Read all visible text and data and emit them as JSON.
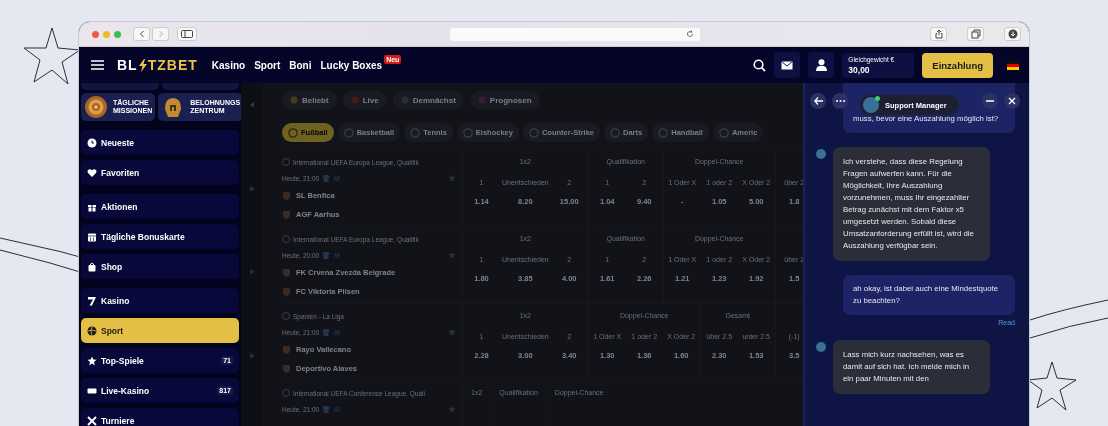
{
  "header": {
    "logo": {
      "left": "BL",
      "right": "TZBET"
    },
    "nav": [
      {
        "label": "Kasino"
      },
      {
        "label": "Sport"
      },
      {
        "label": "Boni"
      },
      {
        "label": "Lucky Boxes",
        "badge": "Neu"
      }
    ],
    "balance_label": "Gleichgewicht €",
    "balance": "30,00",
    "deposit_button": "Einzahlung"
  },
  "sidebar": {
    "promo_cards": [
      {
        "lines": [
          "TÄGLICHE",
          "MISSIONEN"
        ]
      },
      {
        "lines": [
          "BELOHNUNGS",
          "ZENTRUM"
        ]
      }
    ],
    "groups": [
      {
        "items": [
          {
            "label": "Neueste",
            "selected": false
          },
          {
            "label": "Favoriten",
            "selected": false
          }
        ]
      },
      {
        "items": [
          {
            "label": "Aktionen",
            "selected": false
          },
          {
            "label": "Tägliche Bonuskarte",
            "selected": false
          },
          {
            "label": "Shop",
            "selected": false
          }
        ]
      },
      {
        "items": [
          {
            "label": "Kasino",
            "selected": false
          },
          {
            "label": "Sport",
            "selected": true
          },
          {
            "label": "Top-Spiele",
            "selected": false,
            "count": "71"
          },
          {
            "label": "Live-Kasino",
            "selected": false,
            "count": "817"
          },
          {
            "label": "Turniere",
            "selected": false
          }
        ]
      }
    ]
  },
  "filters": [
    {
      "label": "Beliebt"
    },
    {
      "label": "Live"
    },
    {
      "label": "Demnächst"
    },
    {
      "label": "Prognosen"
    }
  ],
  "sports": [
    {
      "label": "Fußball",
      "selected": true
    },
    {
      "label": "Basketball",
      "selected": false
    },
    {
      "label": "Tennis",
      "selected": false
    },
    {
      "label": "Eishockey",
      "selected": false
    },
    {
      "label": "Counter-Strike",
      "selected": false
    },
    {
      "label": "Darts",
      "selected": false
    },
    {
      "label": "Handball",
      "selected": false
    },
    {
      "label": "Americ",
      "selected": false
    }
  ],
  "matches": [
    {
      "league": "International UEFA Europa League, Qualifik",
      "time": "Heute, 21:00",
      "teams": [
        "SL Benfica",
        "AGF Aarhus"
      ],
      "markets": [
        {
          "title": "1x2",
          "outcomes": [
            {
              "label": "1",
              "odd": "1.14"
            },
            {
              "label": "Unentschieden",
              "odd": "8.20"
            },
            {
              "label": "2",
              "odd": "15.00"
            }
          ]
        },
        {
          "title": "Qualifikation",
          "outcomes": [
            {
              "label": "1",
              "odd": "1.04"
            },
            {
              "label": "2",
              "odd": "9.40"
            }
          ]
        },
        {
          "title": "Doppel-Chance",
          "outcomes": [
            {
              "label": "1 Oder X",
              "odd": "-"
            },
            {
              "label": "1 oder 2",
              "odd": "1.05"
            },
            {
              "label": "X Oder 2",
              "odd": "5.00"
            }
          ]
        },
        {
          "outcomes": [
            {
              "label": "über 2",
              "odd": "1.8"
            }
          ]
        }
      ]
    },
    {
      "league": "International UEFA Europa League, Qualifik",
      "time": "Heute, 20:00",
      "teams": [
        "FK Crvena Zvezda Belgrade",
        "FC Viktoria Pilsen"
      ],
      "markets": [
        {
          "title": "1x2",
          "outcomes": [
            {
              "label": "1",
              "odd": "1.80"
            },
            {
              "label": "Unentschieden",
              "odd": "3.85"
            },
            {
              "label": "2",
              "odd": "4.00"
            }
          ]
        },
        {
          "title": "Qualifikation",
          "outcomes": [
            {
              "label": "1",
              "odd": "1.61"
            },
            {
              "label": "2",
              "odd": "2.26"
            }
          ]
        },
        {
          "title": "Doppel-Chance",
          "outcomes": [
            {
              "label": "1 Oder X",
              "odd": "1.21"
            },
            {
              "label": "1 oder 2",
              "odd": "1.23"
            },
            {
              "label": "X Oder 2",
              "odd": "1.92"
            }
          ]
        },
        {
          "outcomes": [
            {
              "label": "über 2",
              "odd": "1.5"
            }
          ]
        }
      ]
    },
    {
      "league": "Spanien - La Liga",
      "time": "Heute, 21:00",
      "teams": [
        "Rayo Vallecano",
        "Deportivo Alaves"
      ],
      "markets": [
        {
          "title": "1x2",
          "outcomes": [
            {
              "label": "1",
              "odd": "2.28"
            },
            {
              "label": "Unentschieden",
              "odd": "3.00"
            },
            {
              "label": "2",
              "odd": "3.40"
            }
          ]
        },
        {
          "title": "Doppel-Chance",
          "outcomes": [
            {
              "label": "1 Oder X",
              "odd": "1.30"
            },
            {
              "label": "1 oder 2",
              "odd": "1.36"
            },
            {
              "label": "X Oder 2",
              "odd": "1.60"
            }
          ]
        },
        {
          "title": "Gesamt",
          "outcomes": [
            {
              "label": "über 2.5",
              "odd": "2.30"
            },
            {
              "label": "unter 2.5",
              "odd": "1.53"
            }
          ]
        },
        {
          "outcomes": [
            {
              "label": "(-1)",
              "odd": "3.5"
            }
          ]
        }
      ]
    },
    {
      "league": "International UEFA Conference League, Quali",
      "time": "Heute, 21:00",
      "markets": [
        {
          "title": "1x2"
        },
        {
          "title": "Qualifikation"
        },
        {
          "title": "Doppel-Chance"
        }
      ]
    }
  ],
  "chat": {
    "agent": "Support Manager",
    "online": true,
    "messages": [
      {
        "kind": "user",
        "text": "muss, bevor eine Auszahlung möglich ist?"
      },
      {
        "kind": "agent",
        "text": "Ich verstehe, dass diese Regelung Fragen aufwerfen kann. Für die Möglichkeit, Ihre Auszahlung vorzunehmen, muss Ihr eingezahlter Betrag zunächst mit dem Faktor x5 umgesetzt werden. Sobald diese Umsatzanforderung erfüllt ist, wird die Auszahlung verfügbar sein."
      },
      {
        "kind": "user",
        "text": "ah okay, ist dabei auch eine Mindestquote zu beachten?",
        "status": "Read"
      },
      {
        "kind": "agent",
        "text": "Lass mich kurz nachsehen, was es damit auf sich hat. Ich melde mich in ein paar Minuten mit den"
      }
    ]
  }
}
